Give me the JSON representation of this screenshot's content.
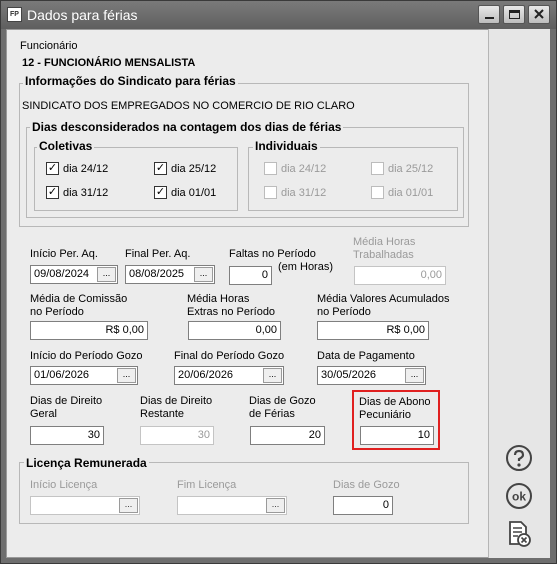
{
  "window": {
    "title": "Dados para férias",
    "app_icon_label": "FP"
  },
  "employee": {
    "label": "Funcionário",
    "value": "12 - FUNCIONÁRIO MENSALISTA"
  },
  "union": {
    "title": "Informações do Sindicato para férias",
    "name": "SINDICATO DOS EMPREGADOS NO COMERCIO DE RIO CLARO",
    "disregarded": {
      "title": "Dias desconsiderados na contagem dos dias de férias",
      "collective": {
        "title": "Coletivas",
        "items": [
          {
            "label": "dia 24/12",
            "checked": true
          },
          {
            "label": "dia 25/12",
            "checked": true
          },
          {
            "label": "dia 31/12",
            "checked": true
          },
          {
            "label": "dia 01/01",
            "checked": true
          }
        ]
      },
      "individual": {
        "title": "Individuais",
        "items": [
          {
            "label": "dia 24/12",
            "checked": false
          },
          {
            "label": "dia 25/12",
            "checked": false
          },
          {
            "label": "dia 31/12",
            "checked": false
          },
          {
            "label": "dia 01/01",
            "checked": false
          }
        ]
      }
    }
  },
  "fields": {
    "inicio_per_aq": {
      "label": "Início Per. Aq.",
      "value": "09/08/2024"
    },
    "final_per_aq": {
      "label": "Final Per. Aq.",
      "value": "08/08/2025"
    },
    "faltas": {
      "label": "Faltas no Período",
      "value": "0"
    },
    "media_horas_trab": {
      "label1": "Média Horas",
      "label2": "Trabalhadas",
      "value": "0,00"
    },
    "faltas_unit": "(em Horas)",
    "media_comissao": {
      "label1": "Média de Comissão",
      "label2": "no Período",
      "value": "R$ 0,00"
    },
    "media_horas_extras": {
      "label1": "Média Horas",
      "label2": "Extras no Período",
      "value": "0,00"
    },
    "media_valores": {
      "label1": "Média Valores Acumulados",
      "label2": "no Período",
      "value": "R$ 0,00"
    },
    "inicio_gozo": {
      "label": "Início do Período Gozo",
      "value": "01/06/2026"
    },
    "final_gozo": {
      "label": "Final do Período Gozo",
      "value": "20/06/2026"
    },
    "data_pagamento": {
      "label": "Data de Pagamento",
      "value": "30/05/2026"
    },
    "dias_direito_geral": {
      "label1": "Dias de Direito",
      "label2": "Geral",
      "value": "30"
    },
    "dias_direito_restante": {
      "label1": "Dias de Direito",
      "label2": "Restante",
      "value": "30"
    },
    "dias_gozo_ferias": {
      "label1": "Dias de Gozo",
      "label2": "de Férias",
      "value": "20"
    },
    "dias_abono": {
      "label1": "Dias de Abono",
      "label2": "Pecuniário",
      "value": "10"
    }
  },
  "licenca": {
    "title": "Licença Remunerada",
    "inicio": {
      "label": "Início Licença",
      "value": ""
    },
    "fim": {
      "label": "Fim Licença",
      "value": ""
    },
    "dias": {
      "label": "Dias de Gozo",
      "value": "0"
    }
  },
  "dropdown_glyph": "...",
  "checkmark_glyph": "✓",
  "sidebar": {
    "help_icon": "help-icon",
    "ok_icon": "ok-icon",
    "cancel_icon": "cancel-document-icon"
  },
  "colors": {
    "highlight": "#e02020",
    "titlebar": "#6b6b6b"
  }
}
